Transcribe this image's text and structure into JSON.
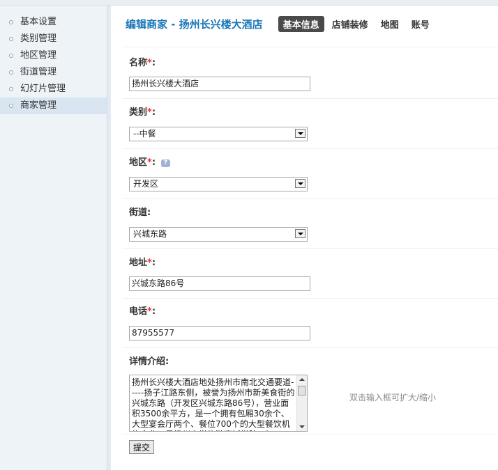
{
  "sidebar": {
    "items": [
      {
        "label": "基本设置"
      },
      {
        "label": "类别管理"
      },
      {
        "label": "地区管理"
      },
      {
        "label": "街道管理"
      },
      {
        "label": "幻灯片管理"
      },
      {
        "label": "商家管理"
      }
    ],
    "active_index": 5
  },
  "header": {
    "title": "编辑商家 - 扬州长兴楼大酒店",
    "tabs": [
      {
        "label": "基本信息"
      },
      {
        "label": "店铺装修"
      },
      {
        "label": "地图"
      },
      {
        "label": "账号"
      }
    ]
  },
  "form": {
    "required_mark": "*",
    "name": {
      "label": "名称",
      "colon": ":",
      "value": "扬州长兴楼大酒店"
    },
    "category": {
      "label": "类别",
      "colon": ":",
      "value": "--中餐"
    },
    "region": {
      "label": "地区",
      "colon": ":",
      "value": "开发区",
      "help": "?"
    },
    "street": {
      "label": "街道:",
      "value": "兴城东路"
    },
    "address": {
      "label": "地址",
      "colon": ":",
      "value": "兴城东路86号"
    },
    "phone": {
      "label": "电话",
      "colon": ":",
      "value": "87955577"
    },
    "detail": {
      "label": "详情介绍:",
      "value": "扬州长兴楼大酒店地处扬州市南北交通要道-----扬子江路东侧，被誉为扬州市新美食街的兴城东路（开发区兴城东路86号），营业面积3500余平方，是一个拥有包厢30余个、大型宴会厅两个、餐位700个的大型餐饮机构企业，是扬州大学旅游烹饪学院、江"
    },
    "textarea_hint": "双击输入框可扩大/缩小",
    "submit_label": "提交"
  },
  "colors": {
    "title": "#1a77b8",
    "required": "#e33333",
    "active_tab_bg": "#4a4a4a",
    "sidebar_bg": "#eef3f8"
  }
}
